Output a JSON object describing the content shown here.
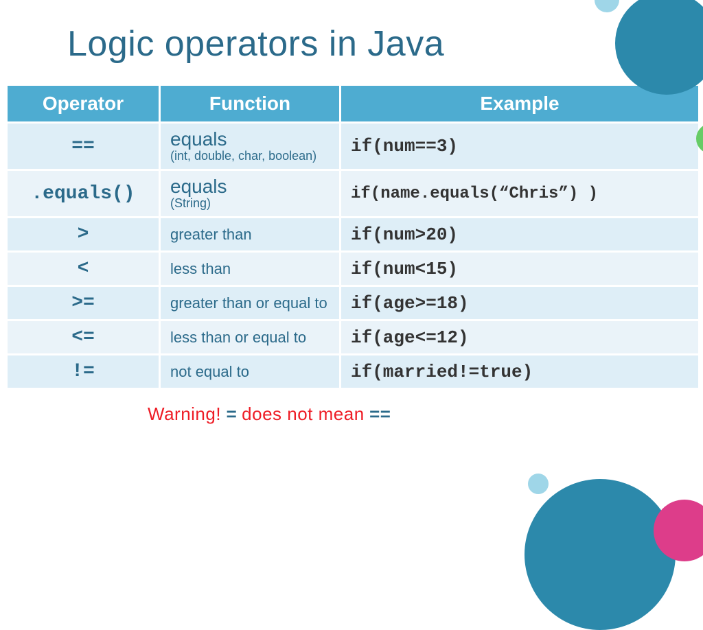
{
  "title": "Logic operators in Java",
  "headers": {
    "c1": "Operator",
    "c2": "Function",
    "c3": "Example"
  },
  "rows": [
    {
      "op": "==",
      "fn": "equals",
      "sub": "(int, double, char, boolean)",
      "ex": "if(num==3)"
    },
    {
      "op": ".equals()",
      "fn": "equals",
      "sub": "(String)",
      "ex": "if(name.equals(“Chris”) )"
    },
    {
      "op": ">",
      "fn": "greater than",
      "sub": "",
      "ex": "if(num>20)"
    },
    {
      "op": "<",
      "fn": "less than",
      "sub": "",
      "ex": "if(num<15)"
    },
    {
      "op": ">=",
      "fn": "greater than or equal to",
      "sub": "",
      "ex": "if(age>=18)"
    },
    {
      "op": "<=",
      "fn": "less than or equal to",
      "sub": "",
      "ex": "if(age<=12)"
    },
    {
      "op": "!=",
      "fn": "not equal to",
      "sub": "",
      "ex": "if(married!=true)"
    }
  ],
  "warning": {
    "w1": "Warning!",
    "w2": "=",
    "w3": "does not mean",
    "w4": "=="
  },
  "colors": {
    "headerBg": "#4eacd1",
    "rowLight": "#eaf3f9",
    "rowDark": "#deeef7",
    "title": "#2b6a8a",
    "warnRed": "#ee1c25"
  }
}
